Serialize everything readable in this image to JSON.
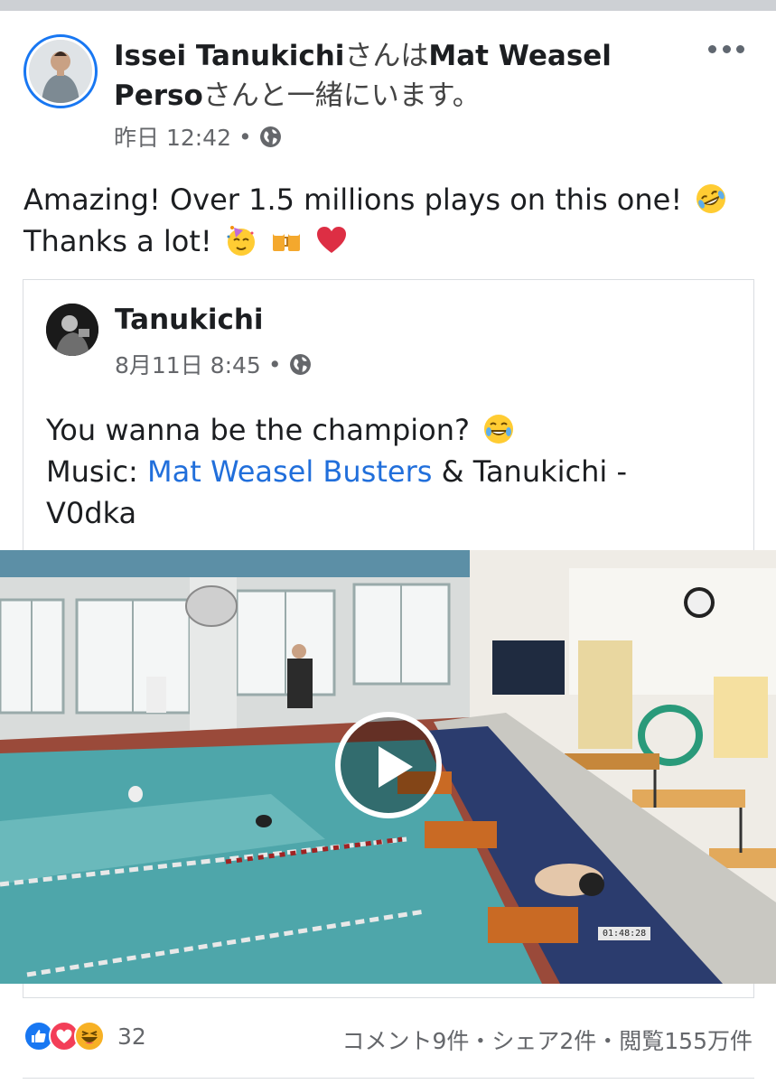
{
  "post": {
    "author": "Issei Tanukichi",
    "with_connector": "さんは",
    "tagged": "Mat Weasel Perso",
    "with_suffix": "さんと一緒にいます。",
    "time": "昨日 12:42",
    "separator": "•",
    "privacy_icon": "globe-icon",
    "menu_icon": "more-horizontal-icon",
    "text_line1": "Amazing! Over 1.5 millions plays on this one!",
    "text_line2": "Thanks a lot!"
  },
  "shared": {
    "author": "Tanukichi",
    "time": "8月11日 8:45",
    "separator": "•",
    "privacy_icon": "globe-icon",
    "text_line1": "You wanna be the champion?",
    "music_label": "Music: ",
    "music_link": "Mat Weasel Busters",
    "music_rest": " & Tanukichi -",
    "text_line3": "V0dka"
  },
  "video": {
    "timestamp": "01:48:28",
    "play_icon": "play-icon"
  },
  "footer": {
    "reaction_icons": [
      "like-icon",
      "love-icon",
      "haha-icon"
    ],
    "reaction_count": "32",
    "stats": "コメント9件・シェア2件・閲覧155万件"
  },
  "colors": {
    "accent": "#1877f2",
    "link": "#216fdb",
    "muted": "#65676b",
    "border": "#dadde1"
  }
}
